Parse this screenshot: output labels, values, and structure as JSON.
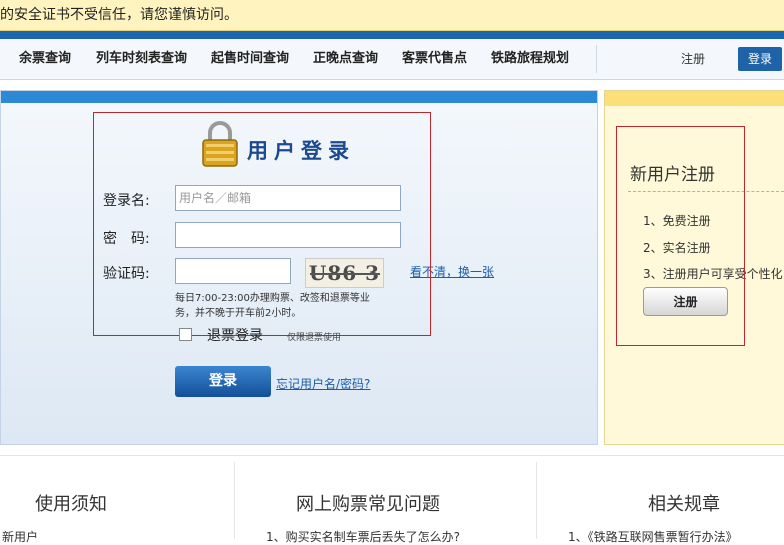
{
  "warning": {
    "text": "的安全证书不受信任，请您谨慎访问。"
  },
  "nav": {
    "items": [
      "余票查询",
      "列车时刻表查询",
      "起售时间查询",
      "正晚点查询",
      "客票代售点",
      "铁路旅程规划"
    ],
    "register": "注册",
    "login": "登录"
  },
  "login_form": {
    "title": "用户登录",
    "username_label": "登录名:",
    "username_placeholder": "用户名／邮箱",
    "password_label": "密　码:",
    "captcha_label": "验证码:",
    "captcha_text": "U86 3",
    "refresh_link": "看不清，换一张",
    "note": "每日7:00-23:00办理购票、改签和退票等业务，并不晚于开车前2小时。",
    "refund_label": "退票登录",
    "refund_note": "仅限退票使用",
    "submit": "登录",
    "forgot_link": "忘记用户名/密码?"
  },
  "register_panel": {
    "title": "新用户注册",
    "items": [
      "1、免费注册",
      "2、实名注册",
      "3、注册用户可享受个性化"
    ],
    "button": "注册"
  },
  "bottom": {
    "col1_title": "使用须知",
    "col1_item": "新用户",
    "col2_title": "网上购票常见问题",
    "col2_item": "1、购买实名制车票后丢失了怎么办?",
    "col3_title": "相关规章",
    "col3_item": "1、《铁路互联网售票暂行办法》"
  },
  "colors": {
    "brand_blue": "#1b66b0",
    "warning_bg": "#fff4bf",
    "annotation_red": "#c0272d"
  }
}
